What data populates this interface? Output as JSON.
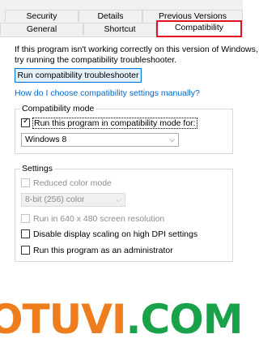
{
  "tabs": {
    "row1": [
      "Security",
      "Details",
      "Previous Versions"
    ],
    "row2": [
      "General",
      "Shortcut",
      "Compatibility"
    ],
    "active": "Compatibility"
  },
  "intro": {
    "line1": "If this program isn't working correctly on this version of Windows,",
    "line2": "try running the compatibility troubleshooter."
  },
  "troubleshooter_button": "Run compatibility troubleshooter",
  "manual_link": "How do I choose compatibility settings manually?",
  "compat_mode": {
    "title": "Compatibility mode",
    "checkbox_label": "Run this program in compatibility mode for:",
    "checked": true,
    "selected_os": "Windows 8"
  },
  "settings": {
    "title": "Settings",
    "reduced_color": {
      "label": "Reduced color mode",
      "checked": false,
      "enabled": false
    },
    "color_depth": {
      "value": "8-bit (256) color",
      "enabled": false
    },
    "res_640": {
      "label": "Run in 640 x 480 screen resolution",
      "checked": false,
      "enabled": false
    },
    "dpi_scaling": {
      "label": "Disable display scaling on high DPI settings",
      "checked": false,
      "enabled": true
    },
    "run_as_admin": {
      "label": "Run this program as an administrator",
      "checked": false,
      "enabled": true
    }
  },
  "watermark": {
    "part1": "OTUVI",
    "part2": ".COM"
  },
  "colors": {
    "link": "#0066cc",
    "highlight": "#e81123",
    "button_border": "#0078d7",
    "watermark_orange": "#ee7d1e",
    "watermark_green": "#1aa24a"
  }
}
